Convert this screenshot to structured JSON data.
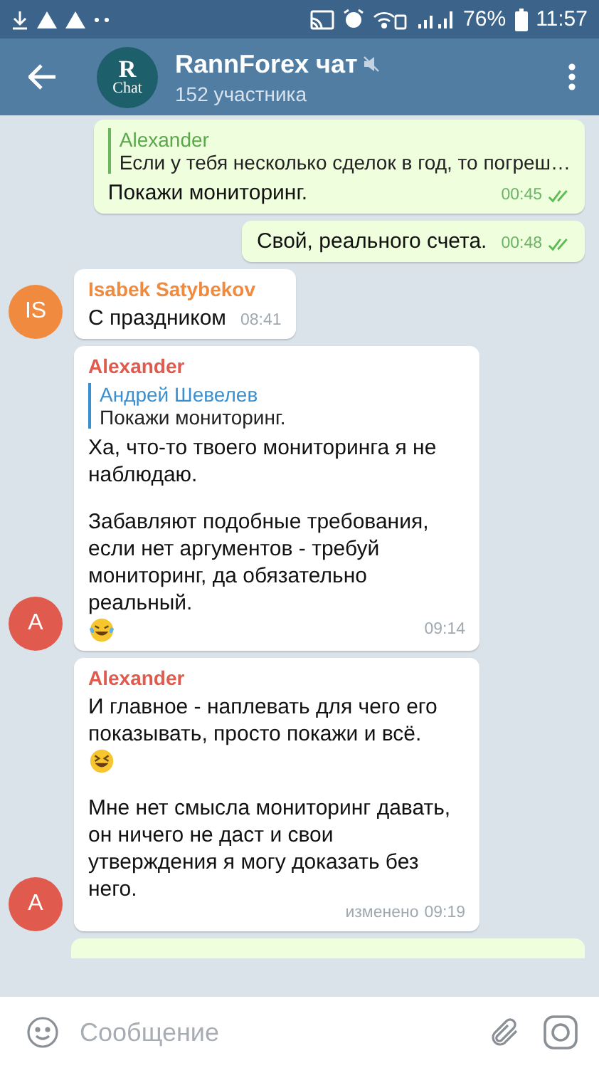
{
  "status_bar": {
    "battery_percent": "76%",
    "time": "11:57"
  },
  "header": {
    "logo": {
      "letter": "R",
      "caption": "Chat"
    },
    "title": "RannForex чат",
    "muted": true,
    "subtitle": "152 участника"
  },
  "messages": [
    {
      "kind": "outgoing",
      "reply": {
        "author": "Alexander",
        "text": "Если у тебя несколько сделок в год, то погреш…"
      },
      "paragraphs": [
        {
          "text": "Покажи мониторинг."
        }
      ],
      "time": "00:45",
      "read": true
    },
    {
      "kind": "outgoing",
      "paragraphs": [
        {
          "text": "Свой, реального счета."
        }
      ],
      "time": "00:48",
      "read": true
    },
    {
      "kind": "incoming",
      "avatar": {
        "initials": "IS",
        "color": "#f08a3e"
      },
      "author": "Isabek Satybekov",
      "paragraphs": [
        {
          "text": "С праздником"
        }
      ],
      "time": "08:41"
    },
    {
      "kind": "incoming",
      "avatar": {
        "initials": "A",
        "color": "#e05a4e"
      },
      "author": "Alexander",
      "reply": {
        "author": "Андрей Шевелев",
        "text": "Покажи мониторинг."
      },
      "paragraphs": [
        {
          "text": "Ха, что-то твоего мониторинга я не наблюдаю."
        },
        {
          "text": "Забавляют подобные требования, если нет аргументов - требуй мониторинг, да обязательно реальный.",
          "emoji": {
            "kind": "tears-of-joy"
          }
        }
      ],
      "time": "09:14"
    },
    {
      "kind": "incoming",
      "avatar": {
        "initials": "A",
        "color": "#e05a4e"
      },
      "author": "Alexander",
      "paragraphs": [
        {
          "text": "И главное - наплевать для чего его показывать, просто покажи и всё.",
          "emoji": {
            "kind": "grinning-squint"
          }
        },
        {
          "text": "Мне нет смысла мониторинг давать, он ничего не даст и свои утверждения я могу доказать без него."
        }
      ],
      "edited": "изменено",
      "time": "09:19"
    },
    {
      "kind": "cut-off"
    }
  ],
  "composer": {
    "placeholder": "Сообщение"
  }
}
